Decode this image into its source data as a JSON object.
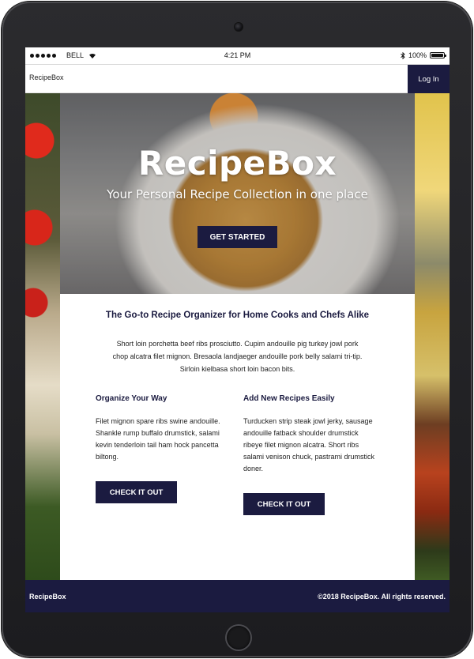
{
  "status_bar": {
    "carrier": "BELL",
    "time": "4:21 PM",
    "battery": "100%",
    "battery_level": 1.0
  },
  "navbar": {
    "brand": "RecipeBox",
    "login_label": "Log In"
  },
  "hero": {
    "title": "RecipeBox",
    "subtitle": "Your Personal Recipe Collection in one place",
    "cta_label": "GET STARTED"
  },
  "main": {
    "tagline": "The Go-to Recipe Organizer for Home Cooks and Chefs Alike",
    "intro": "Short loin porchetta beef ribs prosciutto. Cupim andouille pig turkey jowl pork chop alcatra filet mignon. Bresaola landjaeger andouille pork belly salami tri-tip. Sirloin kielbasa short loin bacon bits.",
    "features": [
      {
        "title": "Organize Your Way",
        "text": "Filet mignon spare ribs swine andouille. Shankle rump buffalo drumstick, salami kevin tenderloin tail ham hock pancetta biltong.",
        "button_label": "CHECK IT OUT"
      },
      {
        "title": "Add New Recipes Easily",
        "text": "Turducken strip steak jowl jerky, sausage andouille fatback shoulder drumstick ribeye filet mignon alcatra. Short ribs salami venison chuck, pastrami drumstick doner.",
        "button_label": "CHECK IT OUT"
      }
    ]
  },
  "footer": {
    "brand": "RecipeBox",
    "copyright": "©2018 RecipeBox. All rights reserved."
  },
  "colors": {
    "primary": "#1b1b40",
    "device": "#1c1c1f",
    "background": "#ffffff"
  }
}
